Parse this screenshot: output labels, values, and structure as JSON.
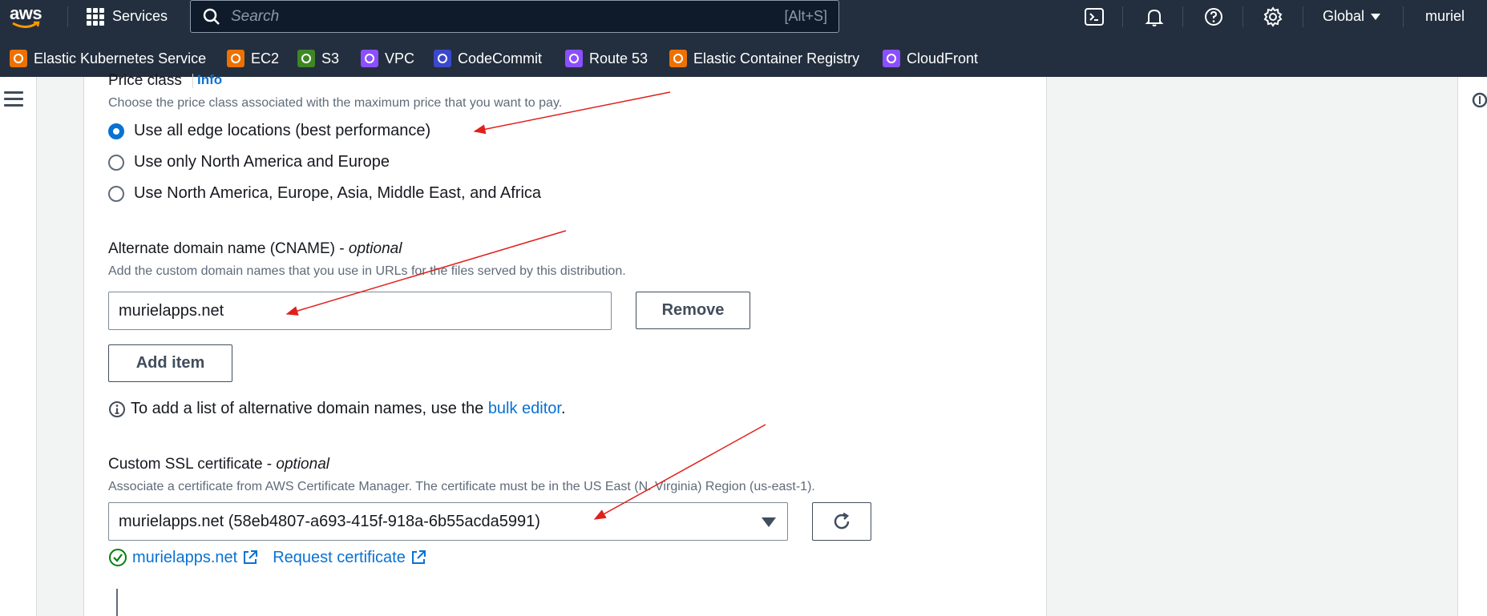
{
  "topbar": {
    "logo_text": "aws",
    "services_label": "Services",
    "search_placeholder": "Search",
    "search_shortcut": "[Alt+S]",
    "region_label": "Global",
    "user_label": "muriel",
    "icons": [
      "cloudshell-icon",
      "bell-icon",
      "help-icon",
      "settings-icon"
    ]
  },
  "favorites": [
    {
      "label": "Elastic Kubernetes Service",
      "color": "#ed7100"
    },
    {
      "label": "EC2",
      "color": "#ed7100"
    },
    {
      "label": "S3",
      "color": "#3f8624"
    },
    {
      "label": "VPC",
      "color": "#8c4fff"
    },
    {
      "label": "CodeCommit",
      "color": "#3b48cc"
    },
    {
      "label": "Route 53",
      "color": "#8c4fff"
    },
    {
      "label": "Elastic Container Registry",
      "color": "#ed7100"
    },
    {
      "label": "CloudFront",
      "color": "#8c4fff"
    }
  ],
  "price_class": {
    "label": "Price class",
    "info_label": "Info",
    "description": "Choose the price class associated with the maximum price that you want to pay.",
    "options": [
      {
        "label": "Use all edge locations (best performance)",
        "checked": true
      },
      {
        "label": "Use only North America and Europe",
        "checked": false
      },
      {
        "label": "Use North America, Europe, Asia, Middle East, and Africa",
        "checked": false
      }
    ]
  },
  "cname": {
    "label": "Alternate domain name (CNAME) - ",
    "label_optional": "optional",
    "description": "Add the custom domain names that you use in URLs for the files served by this distribution.",
    "value": "murielapps.net",
    "remove_label": "Remove",
    "add_item_label": "Add item",
    "bulk_text_before": "To add a list of alternative domain names, use the ",
    "bulk_link": "bulk editor",
    "bulk_text_after": "."
  },
  "ssl": {
    "label": "Custom SSL certificate - ",
    "label_optional": "optional",
    "description": "Associate a certificate from AWS Certificate Manager. The certificate must be in the US East (N. Virginia) Region (us-east-1).",
    "selected": "murielapps.net (58eb4807-a693-415f-918a-6b55acda5991)",
    "cert_link": "murielapps.net",
    "request_link": "Request certificate"
  },
  "colors": {
    "accent": "#0972d3",
    "nav_bg": "#232f3e",
    "annotation": "#e0201b",
    "success": "#037f0c"
  }
}
